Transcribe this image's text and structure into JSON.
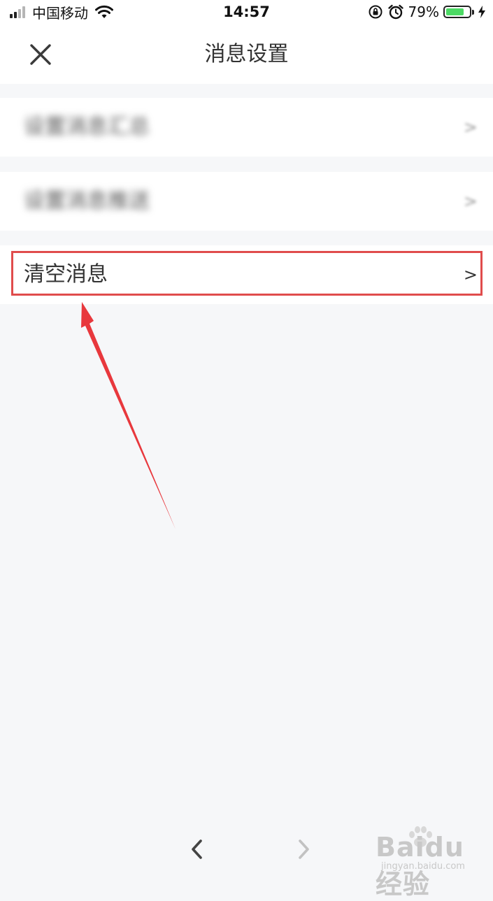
{
  "status_bar": {
    "carrier": "中国移动",
    "time": "14:57",
    "battery_percent": "79%",
    "battery_level": 0.79,
    "icons": [
      "signal-icon",
      "wifi-icon",
      "rotation-lock-icon",
      "alarm-icon",
      "battery-icon",
      "charging-icon"
    ]
  },
  "nav": {
    "title": "消息设置",
    "close_icon": "close-icon"
  },
  "settings": {
    "items": [
      {
        "label": "设置消息汇总",
        "chevron": ">"
      },
      {
        "label": "设置消息推送",
        "chevron": ">"
      },
      {
        "label": "清空消息",
        "chevron": ">"
      }
    ]
  },
  "annotation": {
    "highlight_color": "#e04c4c",
    "arrow_color": "#e8383d"
  },
  "bottom_nav": {
    "back_icon": "chevron-left-icon",
    "forward_icon": "chevron-right-icon"
  },
  "watermark": {
    "text": "Baidu经验",
    "subtext": "jingyan.baidu.com"
  }
}
